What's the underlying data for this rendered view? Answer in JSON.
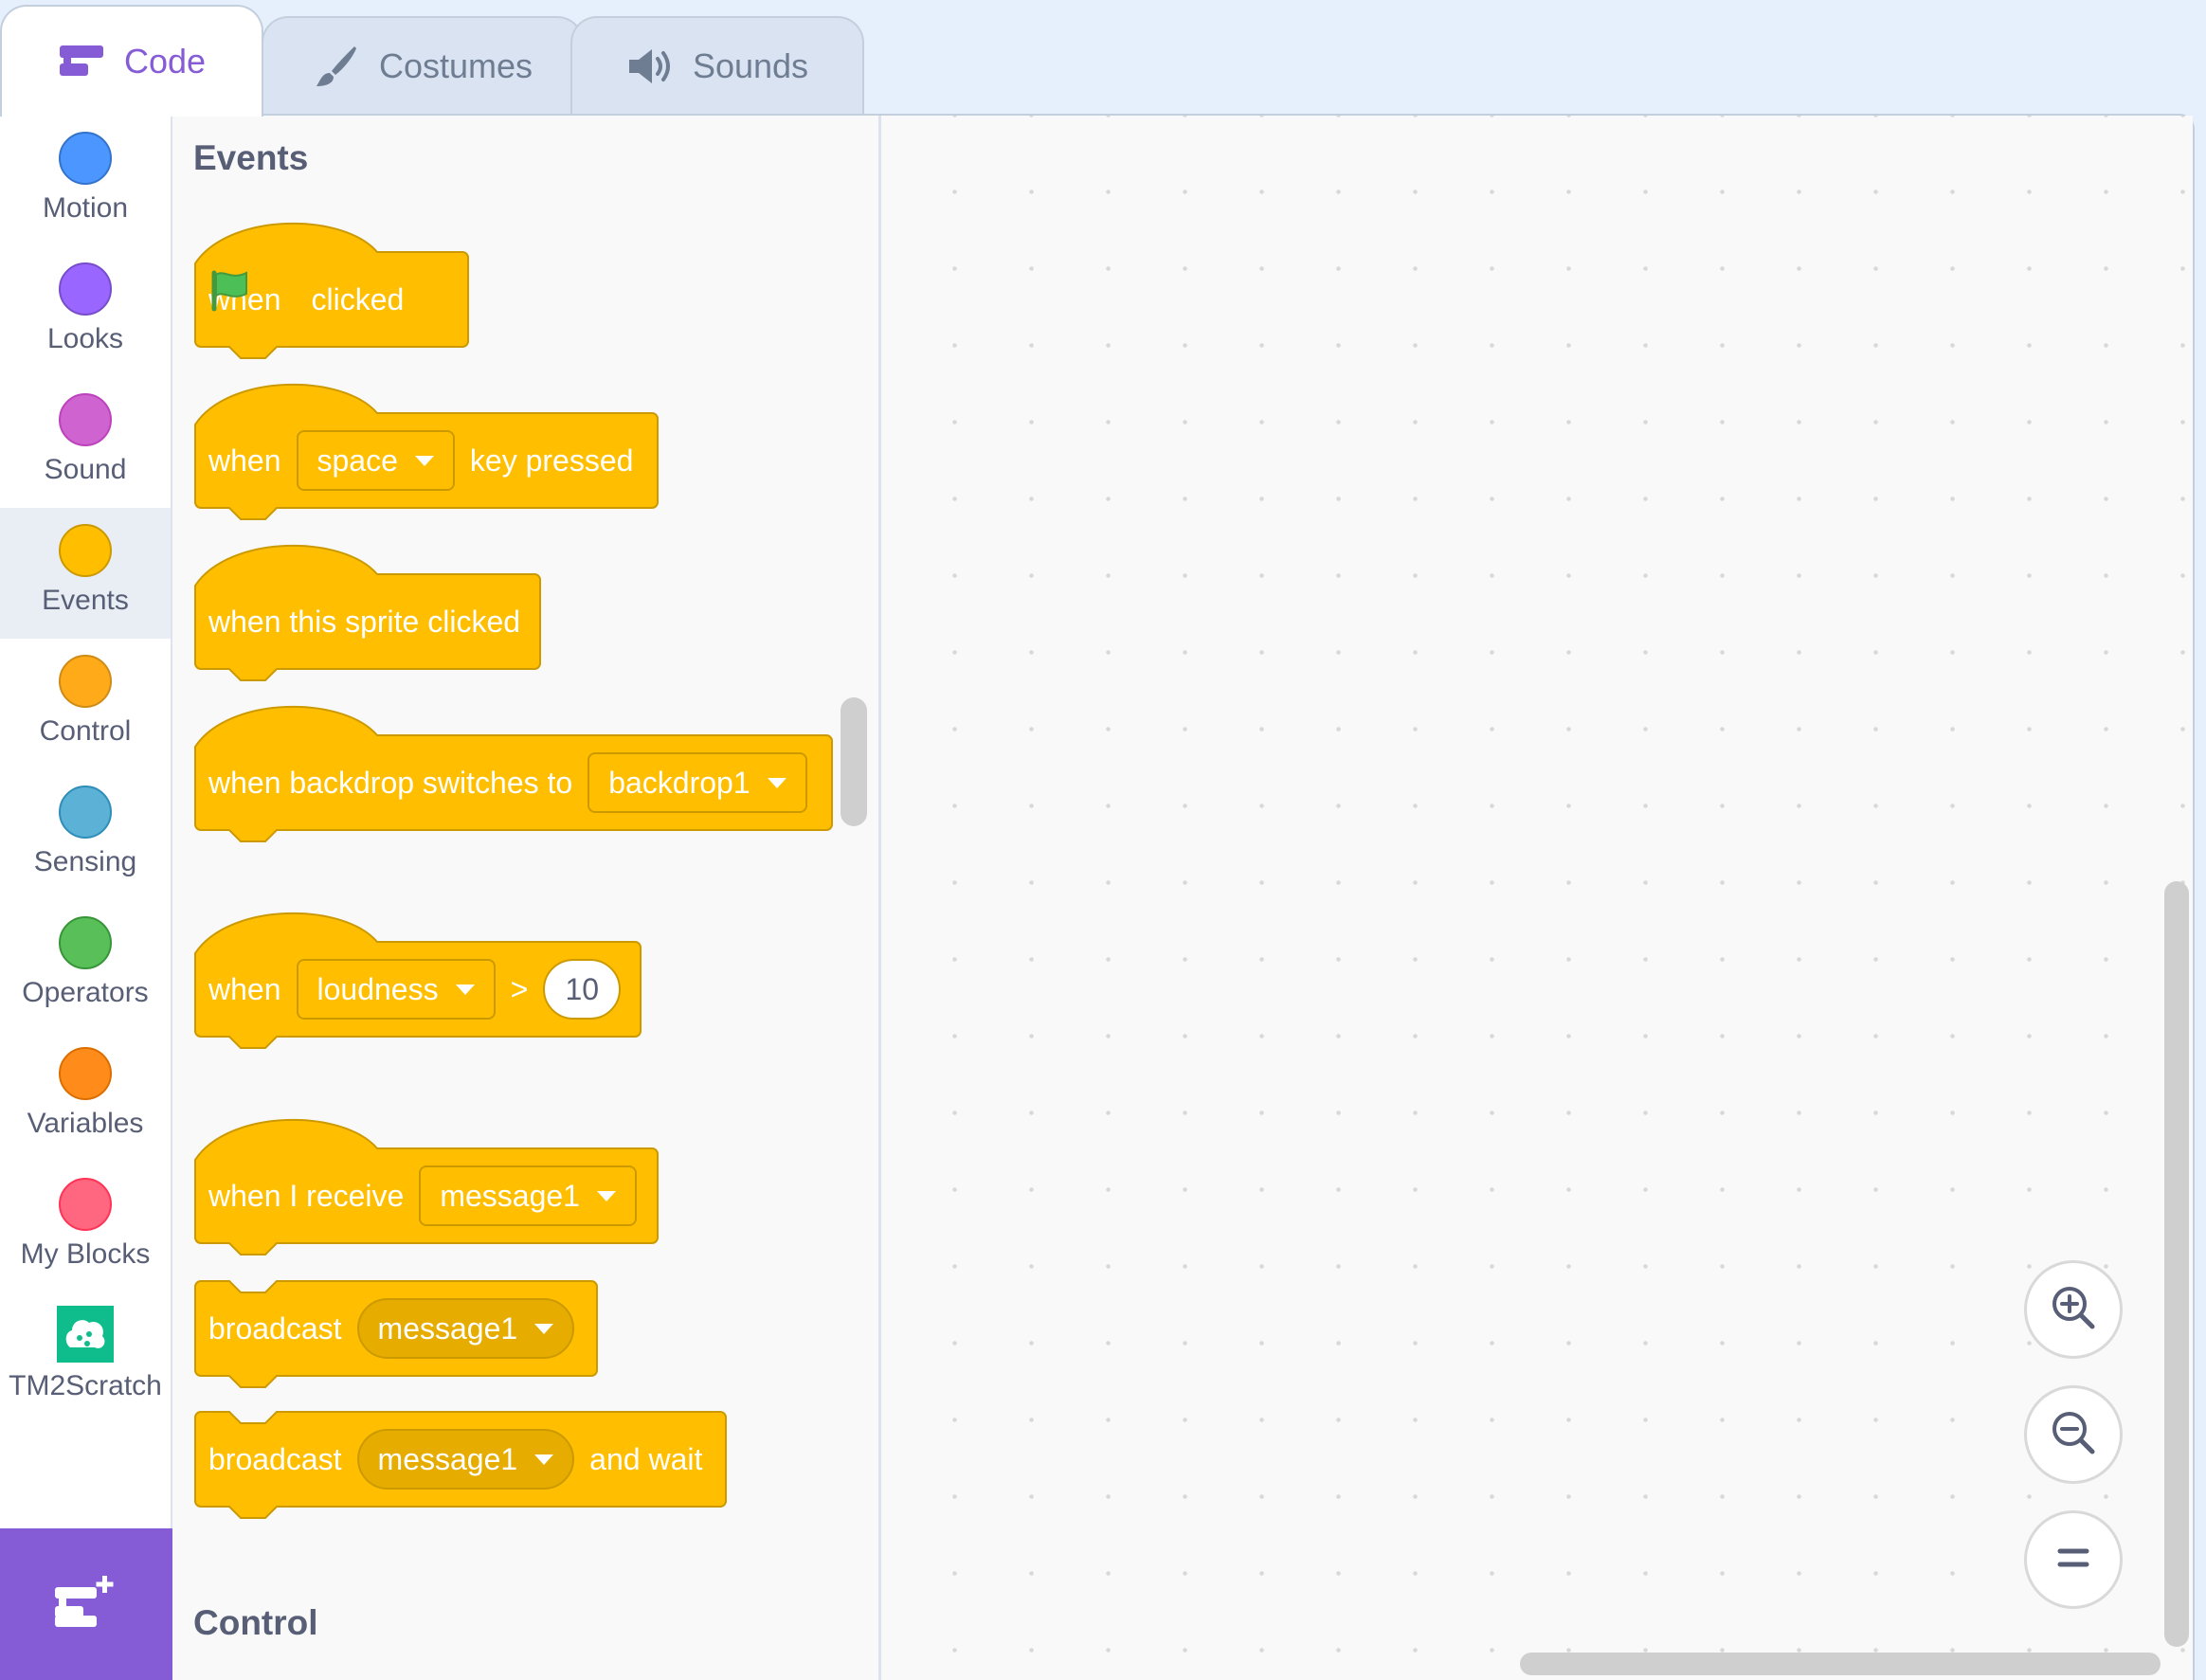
{
  "tabs": [
    {
      "label": "Code",
      "icon": "code-icon",
      "active": true
    },
    {
      "label": "Costumes",
      "icon": "brush-icon",
      "active": false
    },
    {
      "label": "Sounds",
      "icon": "speaker-icon",
      "active": false
    }
  ],
  "categories": [
    {
      "label": "Motion",
      "color": "#4c97ff"
    },
    {
      "label": "Looks",
      "color": "#9966ff"
    },
    {
      "label": "Sound",
      "color": "#cf63cf"
    },
    {
      "label": "Events",
      "color": "#ffbf00",
      "selected": true
    },
    {
      "label": "Control",
      "color": "#ffab19"
    },
    {
      "label": "Sensing",
      "color": "#5cb1d6"
    },
    {
      "label": "Operators",
      "color": "#59c059"
    },
    {
      "label": "Variables",
      "color": "#ff8c1a"
    },
    {
      "label": "My Blocks",
      "color": "#ff6680"
    },
    {
      "label": "TM2Scratch",
      "icon": "tm2scratch-icon"
    }
  ],
  "palette": {
    "section_title": "Events",
    "next_section_title": "Control",
    "blocks": {
      "flag": {
        "when": "when",
        "clicked": "clicked"
      },
      "key": {
        "when": "when",
        "key": "space",
        "rest": "key pressed"
      },
      "sprite": {
        "text": "when this sprite clicked"
      },
      "backdrop": {
        "text": "when backdrop switches to",
        "value": "backdrop1"
      },
      "loudness": {
        "when": "when",
        "sensor": "loudness",
        "op": ">",
        "value": "10"
      },
      "receive": {
        "text": "when I receive",
        "value": "message1"
      },
      "broadcast": {
        "text": "broadcast",
        "value": "message1"
      },
      "broadcast_wait": {
        "text": "broadcast",
        "value": "message1",
        "rest": "and wait"
      }
    }
  },
  "colors": {
    "events": "#ffbf00",
    "events_border": "#cc9900",
    "accent": "#855cd6"
  }
}
